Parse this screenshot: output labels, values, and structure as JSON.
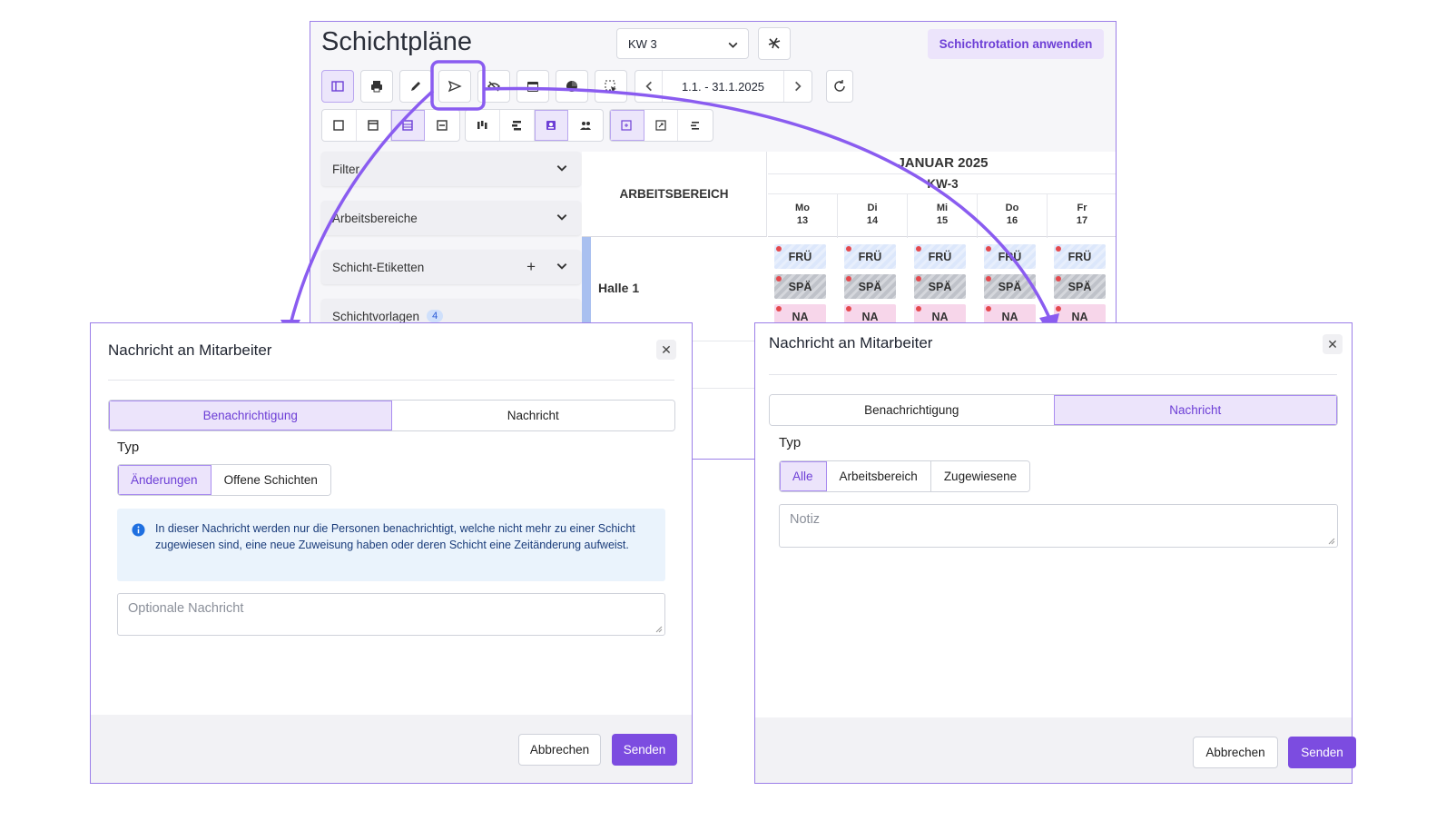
{
  "colors": {
    "accent": "#7c4ce0",
    "accent_light": "#ece4fb",
    "annotation": "#8a5cf0",
    "info_bg": "#eaf3fc",
    "info_icon": "#1f6fe0",
    "dot": "#e5484d"
  },
  "app": {
    "title": "Schichtpläne",
    "week_select": "KW 3",
    "rotation_button": "Schichtrotation anwenden",
    "date_range": "1.1. - 31.1.2025",
    "toolbar_icons": [
      "sidebar-toggle-icon",
      "printer-icon",
      "pencil-icon",
      "send-icon",
      "eye-off-icon",
      "calendar-icon",
      "chart-icon",
      "select-icon"
    ],
    "sidebar": {
      "filter": "Filter",
      "work_areas": "Arbeitsbereiche",
      "shift_tags": "Schicht-Etiketten",
      "shift_templates": "Schichtvorlagen",
      "templates_badge": "4"
    },
    "grid": {
      "column_header": "ARBEITSBEREICH",
      "month": "JANUAR 2025",
      "week": "KW-3",
      "days": [
        {
          "name": "Mo",
          "num": "13"
        },
        {
          "name": "Di",
          "num": "14"
        },
        {
          "name": "Mi",
          "num": "15"
        },
        {
          "name": "Do",
          "num": "16"
        },
        {
          "name": "Fr",
          "num": "17"
        }
      ],
      "row_label": "Halle 1",
      "shifts": [
        "FRÜ",
        "SPÄ",
        "NA"
      ]
    }
  },
  "dialog_left": {
    "title": "Nachricht an Mitarbeiter",
    "tab_notification": "Benachrichtigung",
    "tab_message": "Nachricht",
    "type_label": "Typ",
    "type_changes": "Änderungen",
    "type_open_shifts": "Offene Schichten",
    "info_text": "In dieser Nachricht werden nur die Personen benachrichtigt, welche nicht mehr zu einer Schicht zugewiesen sind, eine neue Zuweisung haben oder deren Schicht eine Zeitänderung aufweist.",
    "message_placeholder": "Optionale Nachricht",
    "cancel": "Abbrechen",
    "send": "Senden"
  },
  "dialog_right": {
    "title": "Nachricht an Mitarbeiter",
    "tab_notification": "Benachrichtigung",
    "tab_message": "Nachricht",
    "type_label": "Typ",
    "type_all": "Alle",
    "type_work_area": "Arbeitsbereich",
    "type_assigned": "Zugewiesene",
    "note_placeholder": "Notiz",
    "cancel": "Abbrechen",
    "send": "Senden"
  }
}
